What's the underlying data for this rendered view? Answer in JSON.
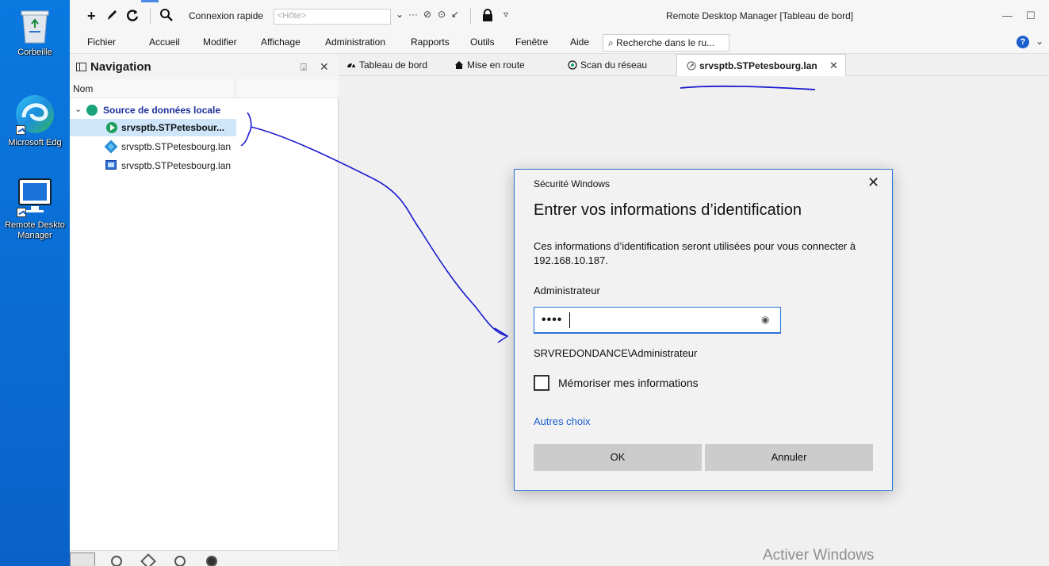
{
  "desktop": {
    "icons": [
      {
        "label": "Corbeille"
      },
      {
        "label": "Microsoft Edg"
      },
      {
        "label": "Remote Deskto Manager"
      }
    ]
  },
  "titlebar": {
    "quick_connect_label": "Connexion rapide",
    "host_placeholder": "<Hôte>",
    "title": "Remote Desktop Manager [Tableau de bord]",
    "window_min": "—",
    "window_max": "☐"
  },
  "menubar": {
    "items": [
      "Fichier",
      "Accueil",
      "Modifier",
      "Affichage",
      "Administration",
      "Rapports",
      "Outils",
      "Fenêtre",
      "Aide"
    ],
    "search_text": "Recherche dans le ru..."
  },
  "navigation": {
    "title": "Navigation",
    "column_header": "Nom",
    "tree": {
      "root": "Source de données locale",
      "items": [
        {
          "label": "srvsptb.STPetesbour..."
        },
        {
          "label": "srvsptb.STPetesbourg.lan"
        },
        {
          "label": "srvsptb.STPetesbourg.lan"
        }
      ]
    }
  },
  "tabs": [
    {
      "label": "Tableau de bord",
      "icon": "dashboard-icon"
    },
    {
      "label": "Mise en route",
      "icon": "home-icon"
    },
    {
      "label": "Scan du réseau",
      "icon": "network-scan-icon"
    },
    {
      "label": "srvsptb.STPetesbourg.lan",
      "icon": "remote-session-icon",
      "active": true
    }
  ],
  "dialog": {
    "window_title": "Sécurité Windows",
    "heading": "Entrer vos informations d’identification",
    "description": "Ces informations d’identification seront utilisées pour vous connecter à 192.168.10.187.",
    "username": "Administrateur",
    "password_mask": "••••",
    "domain_user": "SRVREDONDANCE\\Administrateur",
    "remember_label": "Mémoriser mes informations",
    "remember_checked": false,
    "more_choices": "Autres choix",
    "ok_label": "OK",
    "cancel_label": "Annuler"
  },
  "watermark": "Activer Windows",
  "colors": {
    "accent": "#2d73d8",
    "desktop_bg": "#0a6fd8",
    "tree_root": "#1c2f9c",
    "selection": "#cfe6fa",
    "annotation_ink": "#1a1ad0"
  }
}
